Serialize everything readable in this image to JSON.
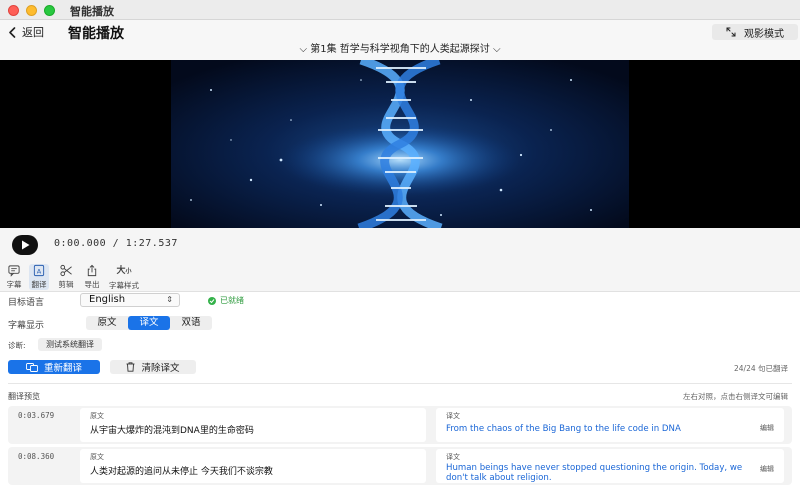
{
  "window": {
    "title": "智能播放"
  },
  "nav": {
    "back_label": "返回",
    "page_title": "智能播放",
    "mode_label": "观影模式"
  },
  "episode": {
    "title": "第1集 哲学与科学视角下的人类起源探讨"
  },
  "player": {
    "time": "0:00.000 / 1:27.537"
  },
  "toolbar": {
    "items": [
      {
        "label": "字幕",
        "icon": "subtitle-icon"
      },
      {
        "label": "翻译",
        "icon": "translate-icon"
      },
      {
        "label": "剪辑",
        "icon": "scissors-icon"
      },
      {
        "label": "导出",
        "icon": "share-icon"
      },
      {
        "label": "字幕样式",
        "icon_text": "大",
        "icon_text_small": "小"
      }
    ],
    "active": "翻译"
  },
  "settings": {
    "target_lang_label": "目标语言",
    "target_lang_value": "English",
    "status": "已就绪",
    "display_label": "字幕显示",
    "display_options": [
      "原文",
      "译文",
      "双语"
    ],
    "display_selected": "译文",
    "diag_label": "诊断:",
    "diag_button": "测试系统翻译"
  },
  "actions": {
    "retranslate": "重新翻译",
    "clear": "清除译文",
    "count": "24/24 句已翻译"
  },
  "preview": {
    "title": "翻译预览",
    "hint": "左右对照，点击右侧译文可编辑",
    "orig_label": "原文",
    "trans_label": "译文",
    "edit_label": "编辑",
    "segments": [
      {
        "time": "0:03.679",
        "original": "从宇宙大爆炸的混沌到DNA里的生命密码",
        "translation": "From the chaos of the Big Bang to the life code in DNA"
      },
      {
        "time": "0:08.360",
        "original": "人类对起源的追问从未停止 今天我们不谈宗教",
        "translation": "Human beings have never stopped questioning the origin. Today, we don't talk about religion."
      }
    ]
  },
  "colors": {
    "accent": "#1a73e8",
    "ready": "#2c9a3c",
    "translation_text": "#1a66d6"
  }
}
